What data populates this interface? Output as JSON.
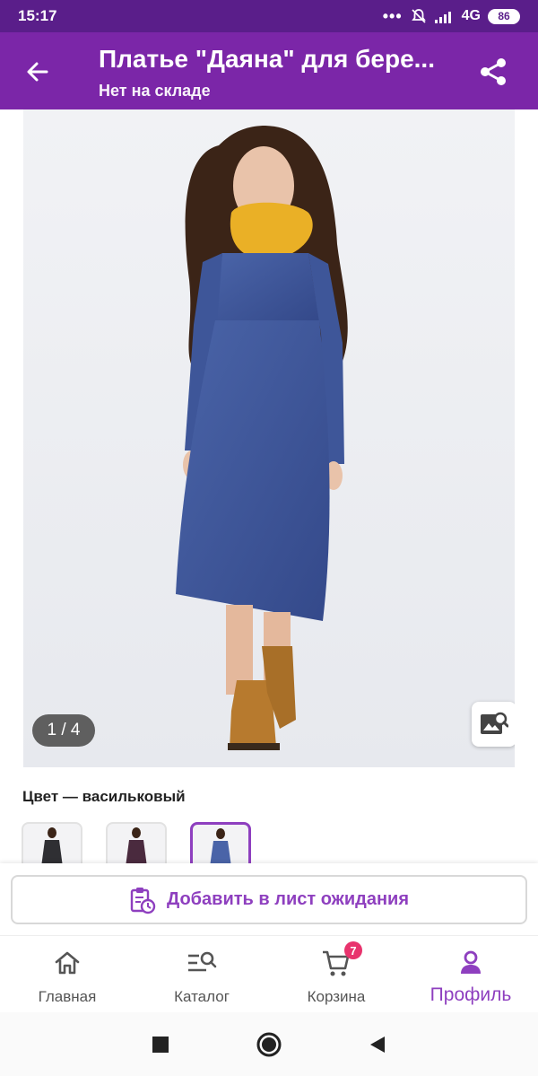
{
  "status_bar": {
    "time": "15:17",
    "network": "4G",
    "battery": "86"
  },
  "app_bar": {
    "title": "Платье \"Даяна\" для бере...",
    "subtitle": "Нет на складе"
  },
  "gallery": {
    "counter": "1 / 4"
  },
  "color": {
    "label": "Цвет — васильковый"
  },
  "waitlist": {
    "label": "Добавить в лист ожидания"
  },
  "bottom_nav": {
    "items": [
      {
        "label": "Главная",
        "icon": "home-icon"
      },
      {
        "label": "Каталог",
        "icon": "catalog-search-icon"
      },
      {
        "label": "Корзина",
        "icon": "cart-icon",
        "badge": "7"
      },
      {
        "label": "Профиль",
        "icon": "profile-icon",
        "active": true
      }
    ]
  },
  "colors": {
    "status_bar": "#5a1e8a",
    "app_bar": "#7b26a8",
    "accent": "#8e3fbf",
    "badge": "#e8336d"
  }
}
